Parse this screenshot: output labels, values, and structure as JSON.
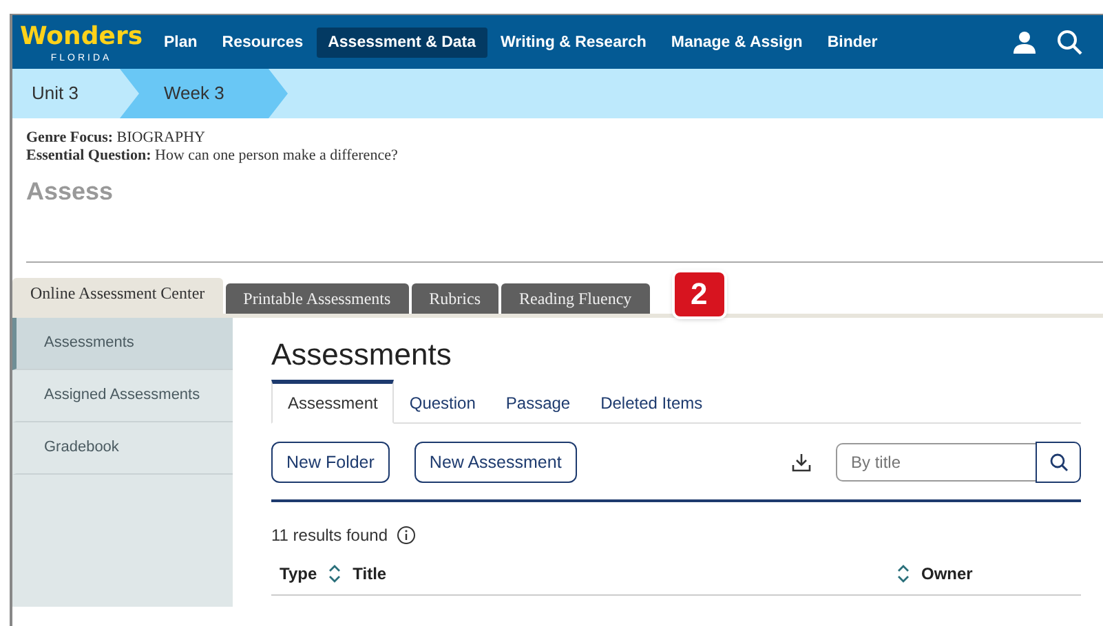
{
  "brand": {
    "name": "Wonders",
    "sub": "FLORIDA"
  },
  "nav": [
    {
      "label": "Plan",
      "selected": false
    },
    {
      "label": "Resources",
      "selected": false
    },
    {
      "label": "Assessment & Data",
      "selected": true
    },
    {
      "label": "Writing & Research",
      "selected": false
    },
    {
      "label": "Manage & Assign",
      "selected": false
    },
    {
      "label": "Binder",
      "selected": false
    }
  ],
  "breadcrumb": [
    {
      "label": "Unit 3",
      "selected": false
    },
    {
      "label": "Week 3",
      "selected": true
    }
  ],
  "info": [
    {
      "label": "Genre Focus:",
      "value": "BIOGRAPHY"
    },
    {
      "label": "Essential Question:",
      "value": "How can one person make a difference?"
    }
  ],
  "page_title": "Assess",
  "tabs": [
    {
      "label": "Online Assessment Center",
      "selected": true
    },
    {
      "label": "Printable Assessments",
      "selected": false
    },
    {
      "label": "Rubrics",
      "selected": false
    },
    {
      "label": "Reading Fluency",
      "selected": false
    }
  ],
  "callout": "2",
  "sidebar": {
    "items": [
      {
        "label": "Assessments",
        "selected": true
      },
      {
        "label": "Assigned Assessments",
        "selected": false
      },
      {
        "label": "Gradebook",
        "selected": false
      }
    ]
  },
  "main": {
    "title": "Assessments",
    "subtabs": [
      {
        "label": "Assessment",
        "selected": true
      },
      {
        "label": "Question",
        "selected": false
      },
      {
        "label": "Passage",
        "selected": false
      },
      {
        "label": "Deleted Items",
        "selected": false
      }
    ],
    "buttons": [
      "New Folder",
      "New Assessment"
    ],
    "search": {
      "placeholder": "By title"
    },
    "results": "11 results found",
    "columns": [
      "Type",
      "Title",
      "Owner"
    ]
  }
}
